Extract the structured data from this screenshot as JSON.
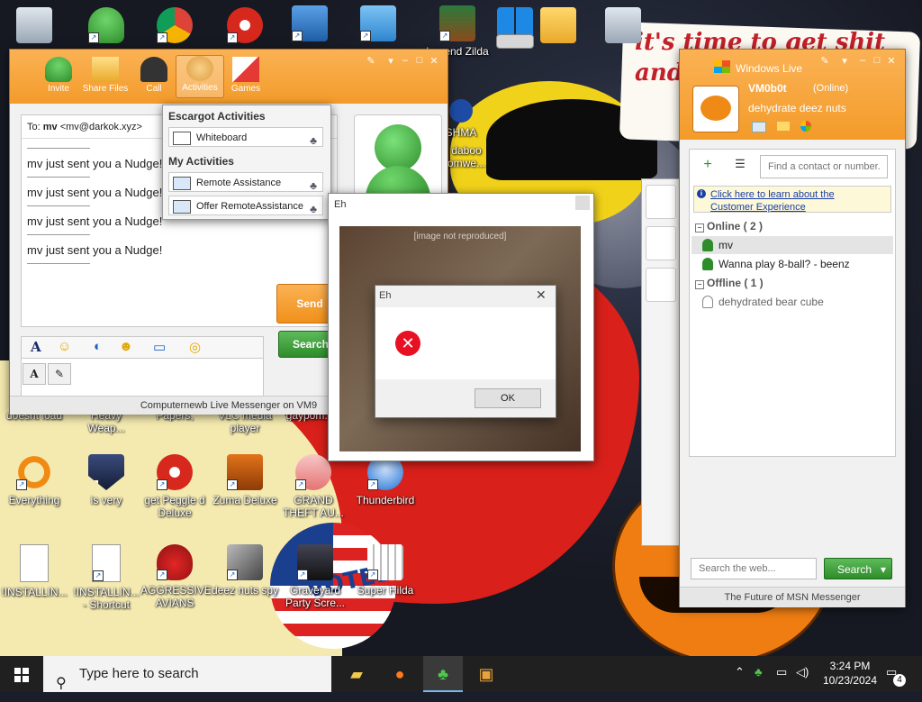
{
  "wallpaper": {
    "banner_text": "it's time to get shit and... or t...",
    "badge_text": "VOTED"
  },
  "desktop_icons": [
    {
      "label": "",
      "icon": "recycle-bin-icon"
    },
    {
      "label": "",
      "icon": "msn-messenger-icon"
    },
    {
      "label": "",
      "icon": "chrome-icon"
    },
    {
      "label": "",
      "icon": "peggle-icon"
    },
    {
      "label": "",
      "icon": "network-icon"
    },
    {
      "label": "",
      "icon": "control-panel-icon"
    },
    {
      "label": "Legend Zilda",
      "icon": "game-character-icon"
    },
    {
      "label": "",
      "icon": "windows-setup-icon"
    },
    {
      "label": "",
      "icon": "drive-icon"
    },
    {
      "label": "",
      "icon": "folder-icon"
    },
    {
      "label": "",
      "icon": "recycle-bin-icon"
    },
    {
      "label": "doesnt load",
      "icon": "app-icon"
    },
    {
      "label": "Heavy Weap...",
      "icon": "app-icon"
    },
    {
      "label": "Papers, Please",
      "icon": "app-icon"
    },
    {
      "label": "VLC media player",
      "icon": "vlc-icon"
    },
    {
      "label": "gaypom...",
      "icon": "app-icon"
    },
    {
      "label": "Everything",
      "icon": "everything-search-icon"
    },
    {
      "label": "is very",
      "icon": "shield-logo-icon"
    },
    {
      "label": "get Peggle d Deluxe",
      "icon": "peggle-icon"
    },
    {
      "label": "Zuma Deluxe",
      "icon": "zuma-icon"
    },
    {
      "label": "GRAND THEFT AU...",
      "icon": "anime-girl-icon"
    },
    {
      "label": "Thunderbird",
      "icon": "thunderbird-icon"
    },
    {
      "label": "!INSTALLIN...",
      "icon": "document-icon"
    },
    {
      "label": "!INSTALLIN... - Shortcut",
      "icon": "document-icon"
    },
    {
      "label": "AGGRESSIVE AVIANS",
      "icon": "angry-bird-icon"
    },
    {
      "label": "deez nuts spy",
      "icon": "windows-stack-icon"
    },
    {
      "label": "Graveyard Party Scre...",
      "icon": "graveyard-icon"
    },
    {
      "label": "Super Hilda",
      "icon": "pixel-cat-icon"
    },
    {
      "label": "daboo omwe...",
      "icon": "app-icon"
    },
    {
      "label": "SHMA",
      "icon": "shield-icon"
    }
  ],
  "chat_window": {
    "toolbar": [
      {
        "label": "Invite",
        "icon": "invite-icon"
      },
      {
        "label": "Share Files",
        "icon": "folder-icon"
      },
      {
        "label": "Call",
        "icon": "phone-icon"
      },
      {
        "label": "Activities",
        "icon": "activities-icon"
      },
      {
        "label": "Games",
        "icon": "cards-icon"
      }
    ],
    "to_label": "To:",
    "to_name": "mv",
    "to_email": "<mv@darkok.xyz>",
    "messages": [
      "mv just sent you a Nudge!",
      "mv just sent you a Nudge!",
      "mv just sent you a Nudge!",
      "mv just sent you a Nudge!"
    ],
    "send_label": "Send",
    "search_label": "Search",
    "footer": "Computernewb Live Messenger on VM9",
    "font_tab": "A"
  },
  "activities_menu": {
    "header1": "Escargot Activities",
    "item1": "Whiteboard",
    "header2": "My Activities",
    "item2": "Remote Assistance",
    "item3": "Offer RemoteAssistance"
  },
  "dialog_outer": {
    "title": "Eh",
    "image_placeholder": "[image not reproduced]"
  },
  "dialog_inner": {
    "title": "Eh",
    "close": "✕",
    "message": "",
    "ok_label": "OK"
  },
  "contact_list": {
    "brand": "Windows Live",
    "display_name": "VM0b0t",
    "status": "(Online)",
    "personal_message": "dehydrate deez nuts",
    "search_placeholder": "Find a contact or number...",
    "info_text": "Click here to learn about the Customer Experience",
    "group_online": "Online ( 2 )",
    "contacts_online": [
      "mv",
      "Wanna play 8-ball? - beenz"
    ],
    "group_offline": "Offline ( 1 )",
    "contacts_offline": [
      "dehydrated bear cube"
    ],
    "web_search_placeholder": "Search the web...",
    "web_search_button": "Search",
    "footer": "The Future of MSN Messenger"
  },
  "taskbar": {
    "search_placeholder": "Type here to search",
    "time": "3:24 PM",
    "date": "10/23/2024",
    "notification_count": "4",
    "apps": [
      "file-explorer-icon",
      "firefox-icon",
      "msn-messenger-icon",
      "media-app-icon"
    ]
  },
  "colors": {
    "msn_orange": "#f39b2a",
    "msn_green": "#2e8c2b",
    "error_red": "#e81123",
    "taskbar": "#202020"
  }
}
